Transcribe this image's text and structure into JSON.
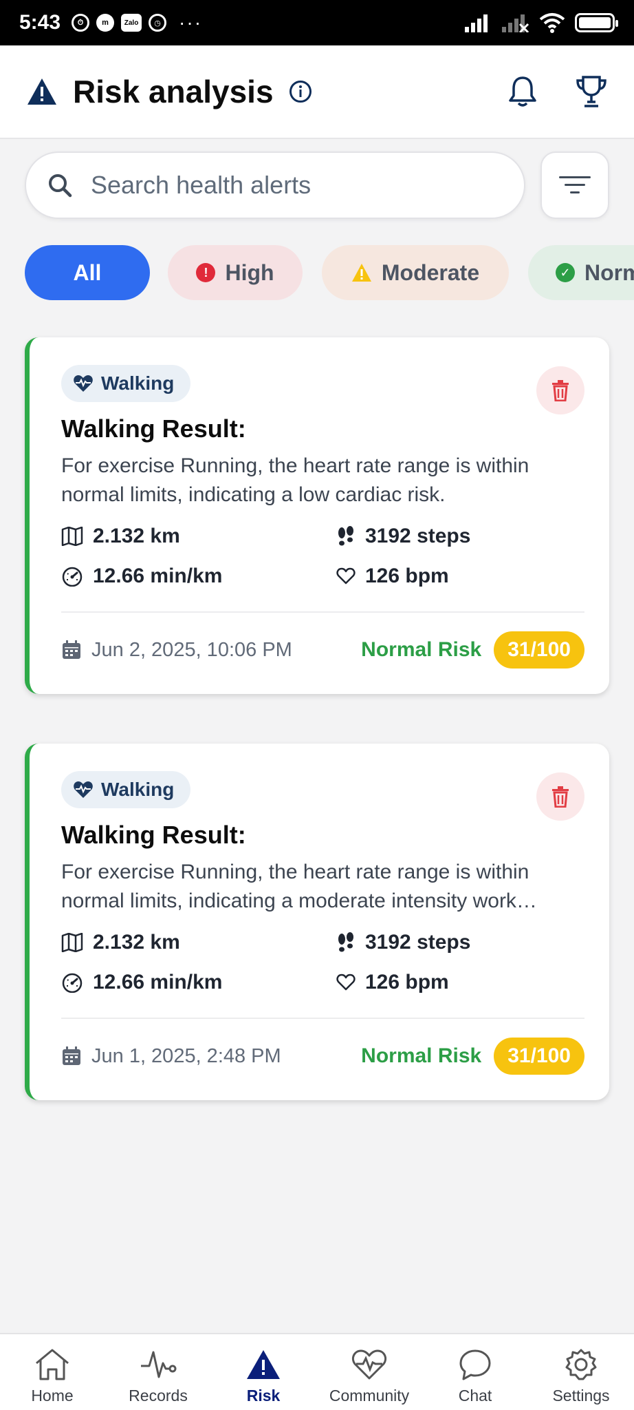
{
  "status_bar": {
    "time": "5:43",
    "zalo_label": "Zalo",
    "more": "···"
  },
  "header": {
    "title": "Risk analysis"
  },
  "search": {
    "placeholder": "Search health alerts"
  },
  "filters": [
    {
      "label": "All"
    },
    {
      "label": "High",
      "icon": "error-icon",
      "color": "#e02a3a"
    },
    {
      "label": "Moderate",
      "icon": "warning-icon",
      "color": "#f7c30f"
    },
    {
      "label": "Normal",
      "icon": "check-circle-icon",
      "color": "#2c9e46"
    }
  ],
  "cards": [
    {
      "tag": "Walking",
      "title": "Walking Result:",
      "description": "For exercise Running, the heart rate range is within normal limits, indicating a low cardiac risk.",
      "distance": "2.132 km",
      "steps": "3192 steps",
      "pace": "12.66 min/km",
      "heart_rate": "126 bpm",
      "date": "Jun 2, 2025, 10:06 PM",
      "risk_label": "Normal Risk",
      "score": "31/100"
    },
    {
      "tag": "Walking",
      "title": "Walking Result:",
      "description": "For exercise Running, the heart rate range is within normal limits, indicating a moderate intensity work…",
      "distance": "2.132 km",
      "steps": "3192 steps",
      "pace": "12.66 min/km",
      "heart_rate": "126 bpm",
      "date": "Jun 1, 2025, 2:48 PM",
      "risk_label": "Normal Risk",
      "score": "31/100"
    }
  ],
  "nav": [
    {
      "label": "Home",
      "icon": "home-icon"
    },
    {
      "label": "Records",
      "icon": "pulse-icon"
    },
    {
      "label": "Risk",
      "icon": "warning-icon",
      "active": true
    },
    {
      "label": "Community",
      "icon": "heart-pulse-icon"
    },
    {
      "label": "Chat",
      "icon": "chat-icon"
    },
    {
      "label": "Settings",
      "icon": "gear-icon"
    }
  ],
  "colors": {
    "primary": "#2f6cf0",
    "risk_normal": "#2c9e46",
    "score_badge": "#f7c30f",
    "nav_active": "#0b1f7a"
  }
}
